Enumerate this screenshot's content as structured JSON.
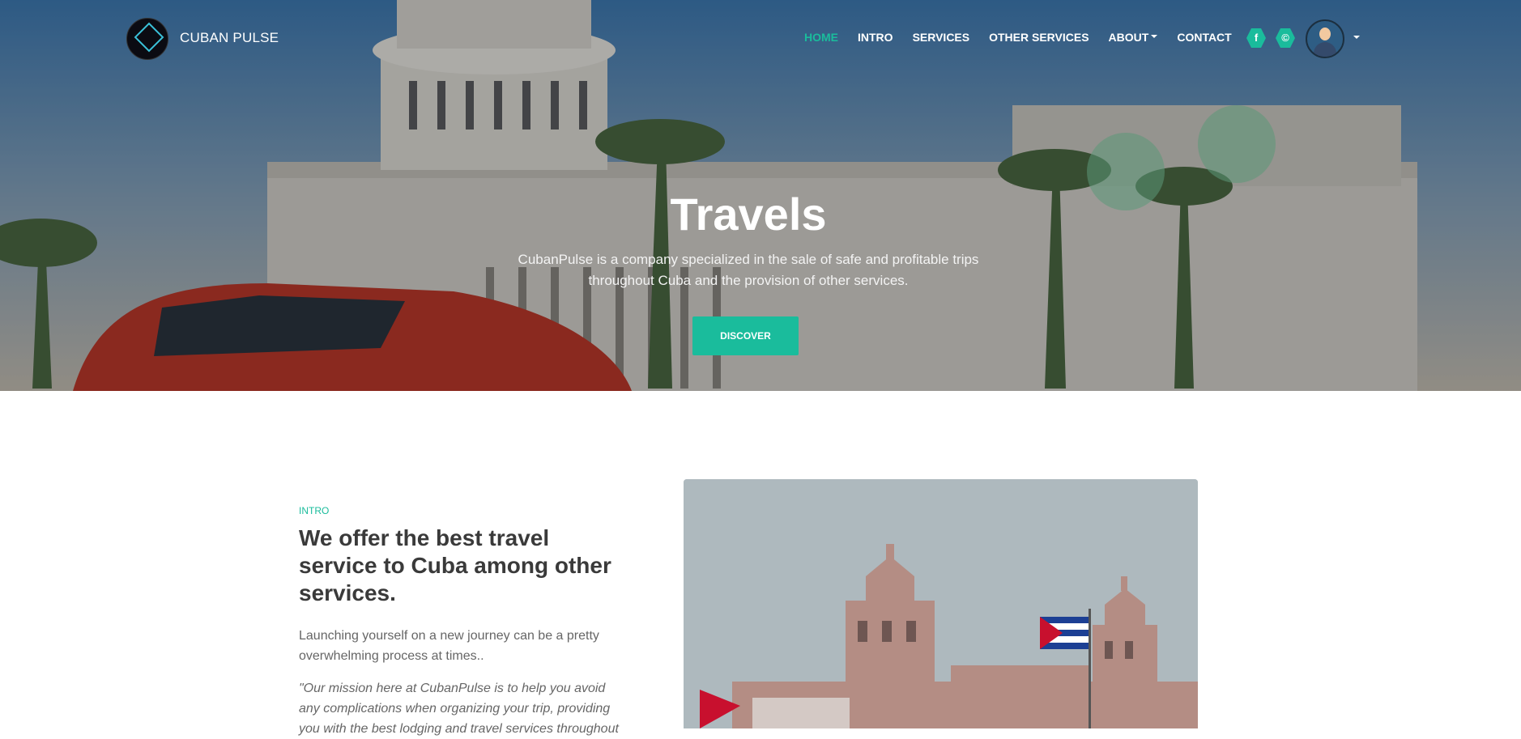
{
  "nav": {
    "brand": "CUBAN PULSE",
    "items": [
      {
        "label": "HOME",
        "active": true
      },
      {
        "label": "INTRO"
      },
      {
        "label": "SERVICES"
      },
      {
        "label": "OTHER SERVICES"
      },
      {
        "label": "ABOUT",
        "dropdown": true
      },
      {
        "label": "CONTACT"
      }
    ],
    "social": [
      {
        "icon": "facebook-icon",
        "glyph": "f"
      },
      {
        "icon": "copyright-icon",
        "glyph": "©"
      }
    ]
  },
  "hero": {
    "title": "Travels",
    "subtitle": "CubanPulse is a company specialized in the sale of safe and profitable trips throughout Cuba and the provision of other services.",
    "button": "DISCOVER"
  },
  "intro": {
    "kicker": "INTRO",
    "title": "We offer the best travel service to Cuba among other services.",
    "paragraph": "Launching yourself on a new journey can be a pretty overwhelming process at times..",
    "quote": "\"Our mission here at CubanPulse is to help you avoid any complications when organizing your trip, providing you with the best lodging and travel services throughout"
  },
  "colors": {
    "accent": "#1abc9c"
  }
}
